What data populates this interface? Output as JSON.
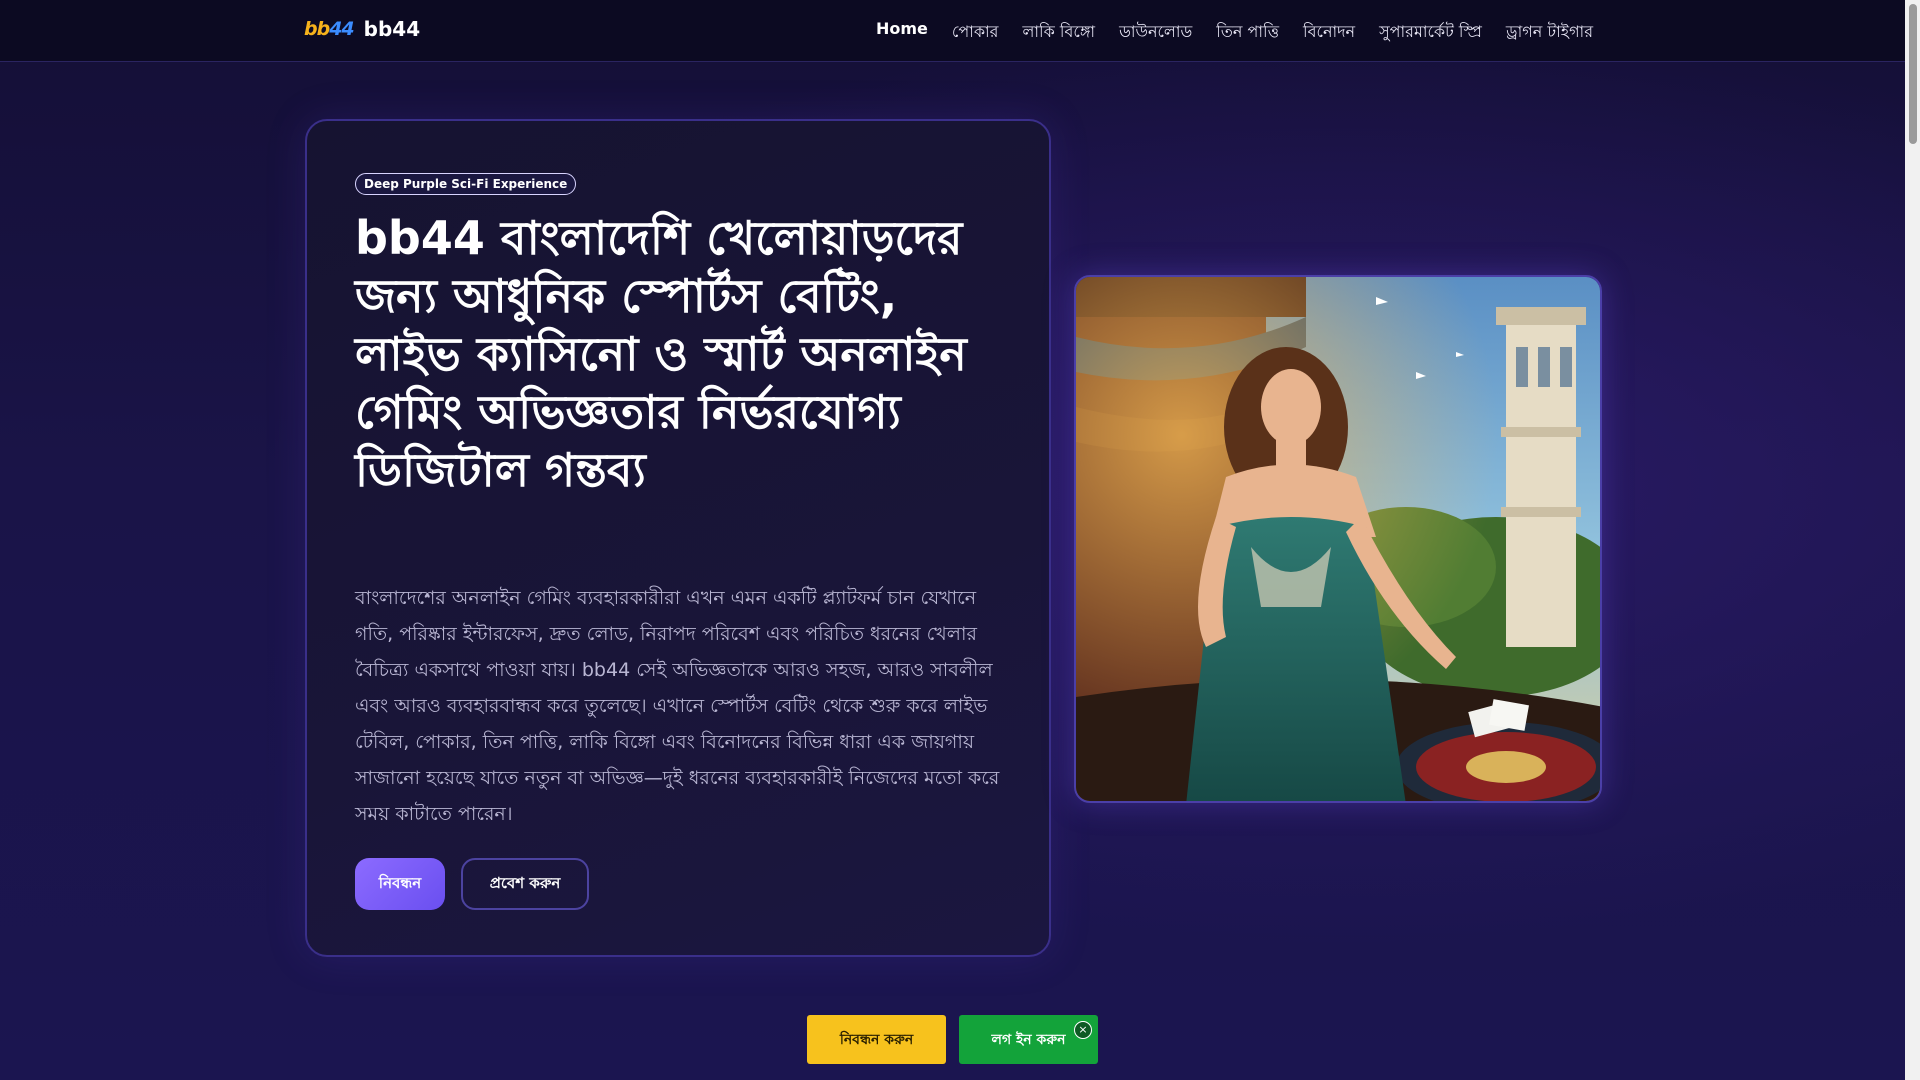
{
  "header": {
    "brand_logo_part1": "bb",
    "brand_logo_part2": "44",
    "brand_name": "bb44",
    "nav": [
      {
        "label": "Home"
      },
      {
        "label": "পোকার"
      },
      {
        "label": "লাকি বিঙ্গো"
      },
      {
        "label": "ডাউনলোড"
      },
      {
        "label": "তিন পাত্তি"
      },
      {
        "label": "বিনোদন"
      },
      {
        "label": "সুপারমার্কেট স্প্রি"
      },
      {
        "label": "ড্রাগন টাইগার"
      }
    ],
    "active_nav": "Home"
  },
  "hero": {
    "badge": "Deep Purple Sci-Fi Experience",
    "title": "bb44 বাংলাদেশি খেলোয়াড়দের জন্য আধুনিক স্পোর্টস বেটিং, লাইভ ক্যাসিনো ও স্মার্ট অনলাইন গেমিং অভিজ্ঞতার নির্ভরযোগ্য ডিজিটাল গন্তব্য",
    "description": "বাংলাদেশের অনলাইন গেমিং ব্যবহারকারীরা এখন এমন একটি প্ল্যাটফর্ম চান যেখানে গতি, পরিষ্কার ইন্টারফেস, দ্রুত লোড, নিরাপদ পরিবেশ এবং পরিচিত ধরনের খেলার বৈচিত্র্য একসাথে পাওয়া যায়। bb44 সেই অভিজ্ঞতাকে আরও সহজ, আরও সাবলীল এবং আরও ব্যবহারবান্ধব করে তুলেছে। এখানে স্পোর্টস বেটিং থেকে শুরু করে লাইভ টেবিল, পোকার, তিন পাত্তি, লাকি বিঙ্গো এবং বিনোদনের বিভিন্ন ধারা এক জায়গায় সাজানো হয়েছে যাতে নতুন বা অভিজ্ঞ—দুই ধরনের ব্যবহারকারীই নিজেদের মতো করে সময় কাটাতে পারেন।",
    "register_button": "নিবন্ধন",
    "login_button": "প্রবেশ করুন"
  },
  "floating_bar": {
    "register_button": "নিবন্ধন করুন",
    "login_button": "লগ ইন করুন",
    "close_icon": "×"
  },
  "colors": {
    "accent_purple": "#7b5cf5",
    "register_yellow": "#f7c21d",
    "login_green": "#13a33a",
    "logo_orange": "#f6b21c",
    "logo_blue": "#3b8cff"
  }
}
